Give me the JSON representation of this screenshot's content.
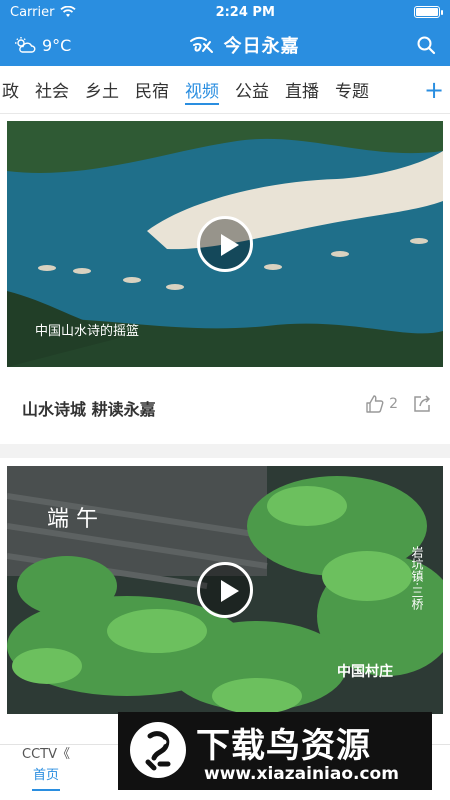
{
  "status_bar": {
    "carrier": "Carrier",
    "time": "2:24 PM"
  },
  "header": {
    "temperature": "9°C",
    "title": "今日永嘉"
  },
  "tabs": [
    {
      "label": "政"
    },
    {
      "label": "社会"
    },
    {
      "label": "乡土"
    },
    {
      "label": "民宿"
    },
    {
      "label": "视频",
      "active": true
    },
    {
      "label": "公益"
    },
    {
      "label": "直播"
    },
    {
      "label": "专题"
    }
  ],
  "tabs_more": "+",
  "feed": [
    {
      "title": "山水诗城 耕读永嘉",
      "likes": "2",
      "overlay_text": "中国山水诗的摇篮"
    },
    {
      "title": "",
      "overlay_text": "端 午",
      "overlay_side_text": "岩坑镇·三桥",
      "overlay_brand": "中国村庄"
    }
  ],
  "next_item_teaser": "CCTV《",
  "bottom_nav": {
    "home_label": "首页"
  },
  "watermark": {
    "text": "下载鸟资源",
    "url": "www.xiazainiao.com"
  },
  "colors": {
    "accent": "#2a8ee0"
  }
}
